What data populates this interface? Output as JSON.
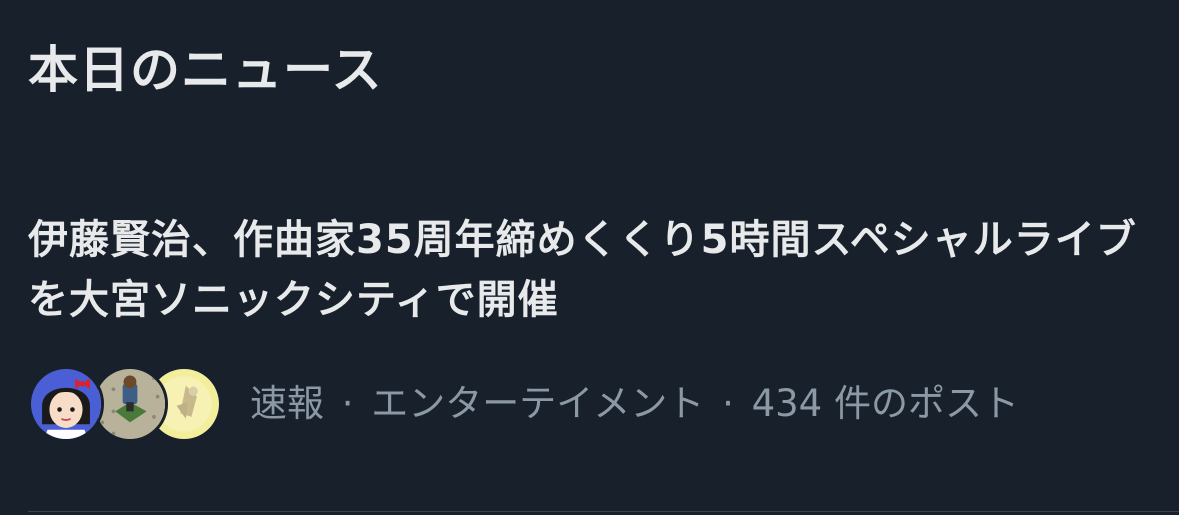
{
  "section": {
    "title": "本日のニュース"
  },
  "news_item": {
    "headline": "伊藤賢治、作曲家35周年締めくくり5時間スペシャルライブを大宮ソニックシティで開催",
    "category": "速報",
    "topic": "エンターテイメント",
    "post_count": "434 件のポスト",
    "separator": "·",
    "avatars": [
      "avatar-1",
      "avatar-2",
      "avatar-3"
    ]
  },
  "colors": {
    "background": "#17202b",
    "primary_text": "#e7e9ea",
    "secondary_text": "#8b98a5",
    "divider": "#38444d"
  }
}
